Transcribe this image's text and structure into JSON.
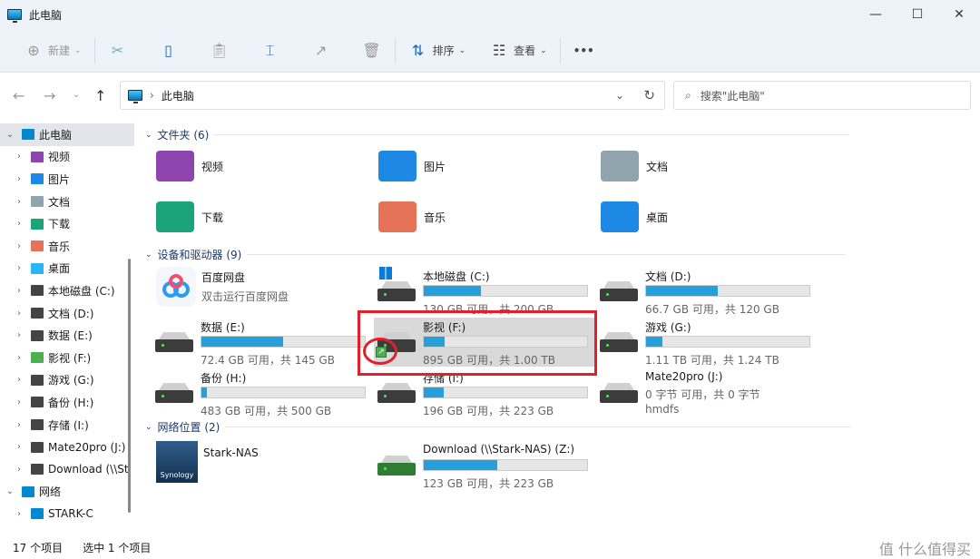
{
  "window": {
    "title": "此电脑",
    "minimize": "—",
    "maximize": "☐",
    "close": "✕"
  },
  "toolbar": {
    "new_label": "新建",
    "sort_label": "排序",
    "view_label": "查看",
    "more": "•••"
  },
  "address": {
    "path": "此电脑",
    "search_placeholder": "搜索\"此电脑\""
  },
  "sidebar": {
    "items": [
      {
        "label": "此电脑",
        "color": "#0288d1",
        "sel": true,
        "chev": "⌄",
        "indent": 0
      },
      {
        "label": "视频",
        "color": "#8e44ad"
      },
      {
        "label": "图片",
        "color": "#1e88e5"
      },
      {
        "label": "文档",
        "color": "#90a4ae"
      },
      {
        "label": "下载",
        "color": "#1ba37a"
      },
      {
        "label": "音乐",
        "color": "#e57357"
      },
      {
        "label": "桌面",
        "color": "#29b6f6"
      },
      {
        "label": "本地磁盘 (C:)",
        "color": "#444"
      },
      {
        "label": "文档 (D:)",
        "color": "#444"
      },
      {
        "label": "数据 (E:)",
        "color": "#444"
      },
      {
        "label": "影视 (F:)",
        "color": "#4caf50"
      },
      {
        "label": "游戏 (G:)",
        "color": "#444"
      },
      {
        "label": "备份 (H:)",
        "color": "#444"
      },
      {
        "label": "存储 (I:)",
        "color": "#444"
      },
      {
        "label": "Mate20pro (J:)",
        "color": "#444"
      },
      {
        "label": "Download (\\\\St",
        "color": "#444"
      },
      {
        "label": "网络",
        "color": "#0288d1",
        "chev": "⌄",
        "indent": 0
      },
      {
        "label": "STARK-C",
        "color": "#0288d1"
      }
    ]
  },
  "groups": {
    "folders": "文件夹 (6)",
    "devices": "设备和驱动器 (9)",
    "network": "网络位置 (2)"
  },
  "folders": [
    {
      "label": "视频",
      "color": "#8e44ad"
    },
    {
      "label": "图片",
      "color": "#1e88e5"
    },
    {
      "label": "文档",
      "color": "#90a4ae"
    },
    {
      "label": "下载",
      "color": "#1ba37a"
    },
    {
      "label": "音乐",
      "color": "#e57357"
    },
    {
      "label": "桌面",
      "color": "#1e88e5"
    }
  ],
  "baidu": {
    "name": "百度网盘",
    "sub": "双击运行百度网盘"
  },
  "drives": [
    {
      "name": "本地磁盘 (C:)",
      "sub": "130 GB 可用，共 200 GB",
      "used": 0.35
    },
    {
      "name": "文档 (D:)",
      "sub": "66.7 GB 可用，共 120 GB",
      "used": 0.44
    },
    {
      "name": "数据 (E:)",
      "sub": "72.4 GB 可用，共 145 GB",
      "used": 0.5
    },
    {
      "name": "影视 (F:)",
      "sub": "895 GB 可用，共 1.00 TB",
      "used": 0.13
    },
    {
      "name": "游戏 (G:)",
      "sub": "1.11 TB 可用，共 1.24 TB",
      "used": 0.1
    },
    {
      "name": "备份 (H:)",
      "sub": "483 GB 可用，共 500 GB",
      "used": 0.034
    },
    {
      "name": "存储 (I:)",
      "sub": "196 GB 可用，共 223 GB",
      "used": 0.12
    },
    {
      "name": "Mate20pro (J:)",
      "sub": "0 字节 可用，共 0 字节",
      "sub2": "hmdfs"
    }
  ],
  "network": {
    "nas": "Stark-NAS",
    "nas_logo": "Synology",
    "download": {
      "name": "Download (\\\\Stark-NAS) (Z:)",
      "sub": "123 GB 可用，共 223 GB",
      "used": 0.45
    }
  },
  "status": {
    "count": "17 个项目",
    "selected": "选中 1 个项目"
  },
  "watermark": "值 什么值得买",
  "highlight_color": "#e0202a"
}
